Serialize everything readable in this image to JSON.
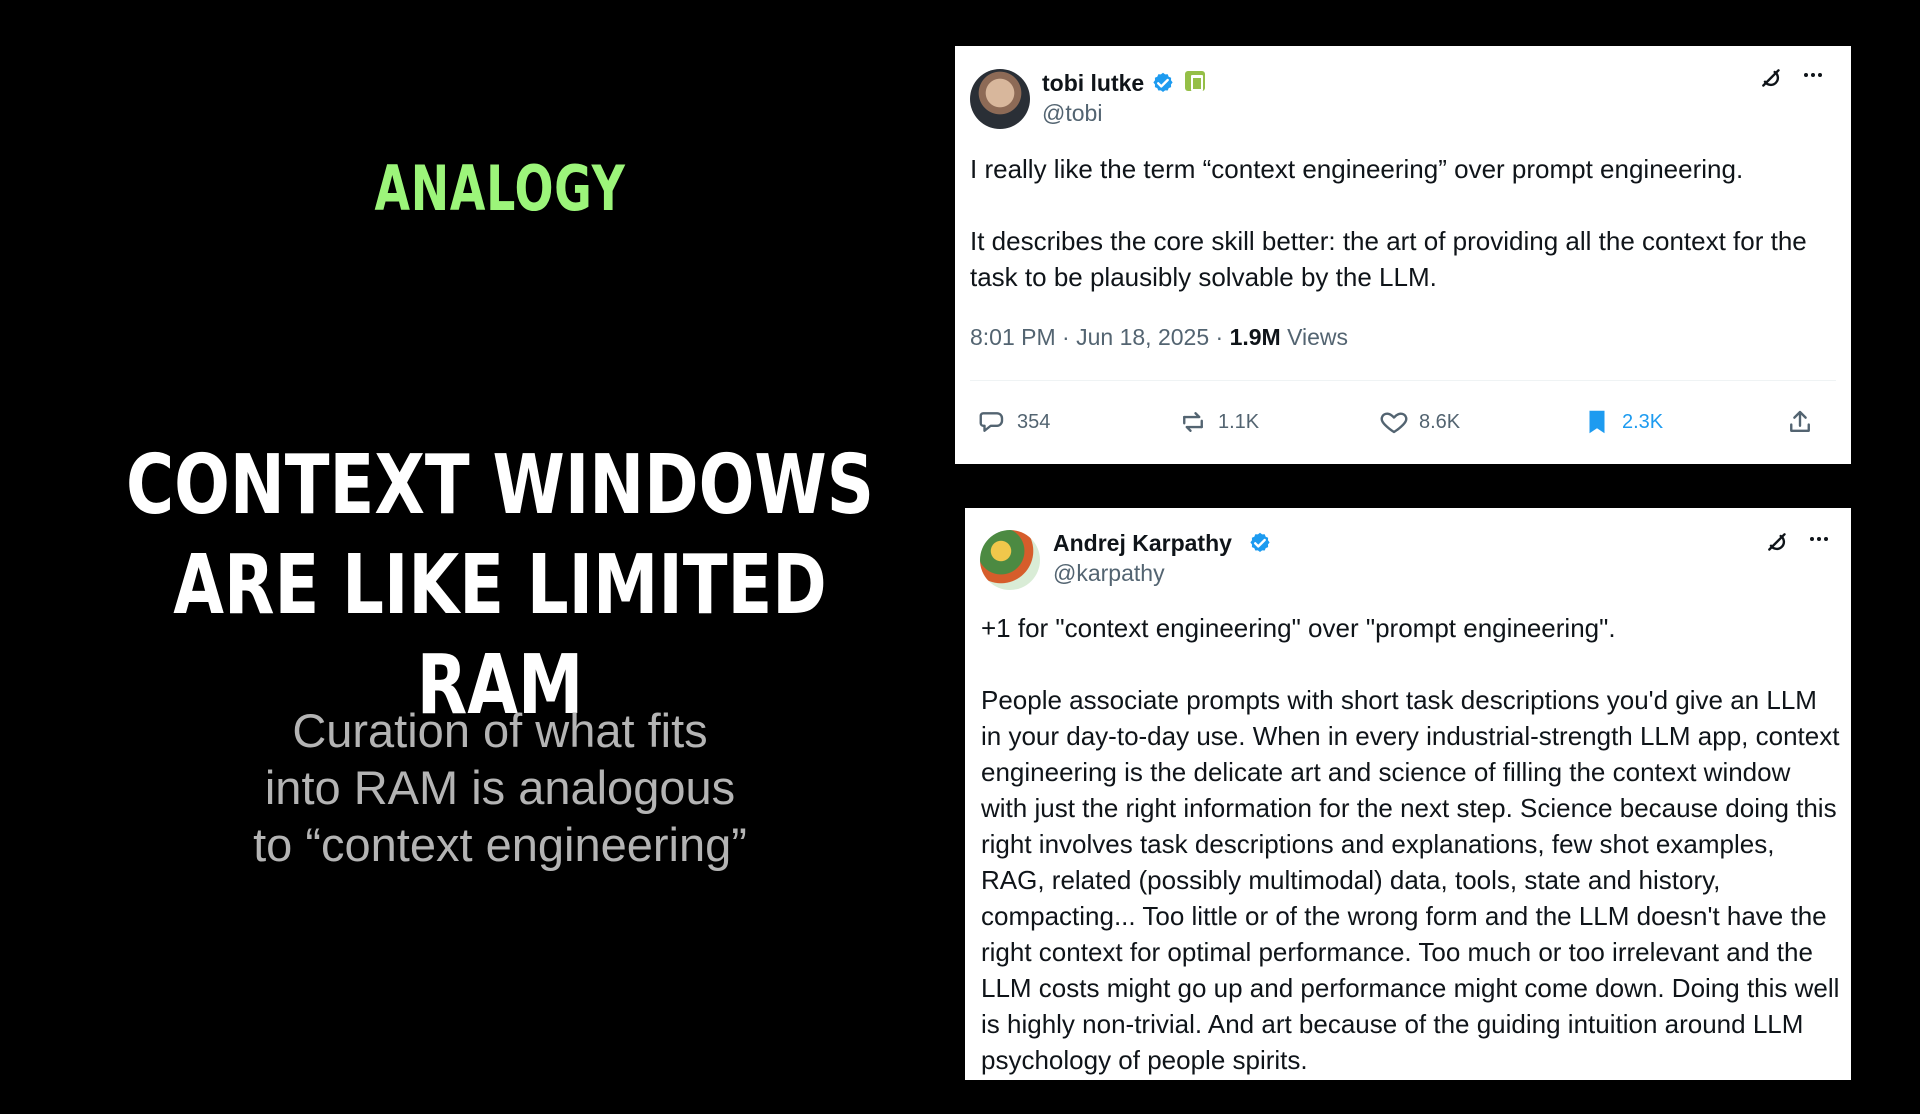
{
  "slide": {
    "kicker": "ANALOGY",
    "headline_lines": [
      "CONTEXT WINDOWS",
      "ARE LIKE LIMITED RAM"
    ],
    "subhead_lines": [
      "Curation of what fits",
      "into RAM is analogous",
      "to “context engineering”"
    ]
  },
  "tweets": {
    "tobi": {
      "name": "tobi lutke",
      "handle": "@tobi",
      "paragraphs": [
        "I really like the term “context engineering” over prompt engineering.",
        "It describes the core skill better: the art of providing all the context for the task to be plausibly solvable by the LLM."
      ],
      "meta": {
        "time": "8:01 PM",
        "date": "Jun 18, 2025",
        "views_count": "1.9M",
        "views_label": "Views"
      },
      "actions": {
        "replies": "354",
        "reposts": "1.1K",
        "likes": "8.6K",
        "bookmarks": "2.3K"
      }
    },
    "karpathy": {
      "name": "Andrej Karpathy",
      "handle": "@karpathy",
      "paragraphs": [
        "+1 for \"context engineering\" over \"prompt engineering\".",
        "People associate prompts with short task descriptions you'd give an LLM in your day-to-day use. When in every industrial-strength LLM app, context engineering is the delicate art and science of filling the context window with just the right information for the next step. Science because doing this right involves task descriptions and explanations, few shot examples, RAG, related (possibly multimodal) data, tools, state and history, compacting... Too little or of the wrong form and the LLM doesn't have the right context for optimal performance. Too much or too irrelevant and the LLM costs might go up and performance might come down. Doing this well is highly non-trivial. And art because of the guiding intuition around LLM psychology of people spirits."
      ]
    }
  },
  "colors": {
    "accent_green": "#9cf57a",
    "twitter_blue": "#1d9bf0"
  },
  "icons": {
    "verified": "verified-badge-icon",
    "shopify": "shopify-bag-icon",
    "grok": "grok-icon",
    "more": "more-icon",
    "reply": "reply-icon",
    "repost": "repost-icon",
    "like": "like-icon",
    "bookmark": "bookmark-icon",
    "share": "share-icon"
  }
}
